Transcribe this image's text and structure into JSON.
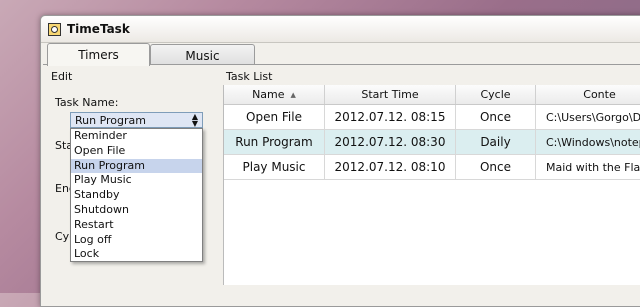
{
  "window": {
    "title": "TimeTask"
  },
  "tabs": [
    {
      "label": "Timers"
    },
    {
      "label": "Music"
    }
  ],
  "edit": {
    "group_label": "Edit",
    "task_name_label": "Task Name:",
    "start_label_partial": "Sta",
    "end_label_partial": "End",
    "cycle_label_partial": "Cyc",
    "selected_task": "Run Program",
    "options": [
      "Reminder",
      "Open File",
      "Run Program",
      "Play Music",
      "Standby",
      "Shutdown",
      "Restart",
      "Log off",
      "Lock"
    ]
  },
  "task_list": {
    "group_label": "Task List",
    "columns": [
      "Name",
      "Start Time",
      "Cycle",
      "Conte"
    ],
    "rows": [
      {
        "name": "Open File",
        "start": "2012.07.12. 08:15",
        "cycle": "Once",
        "content": "C:\\Users\\Gorgo\\Desk"
      },
      {
        "name": "Run Program",
        "start": "2012.07.12. 08:30",
        "cycle": "Daily",
        "content": "C:\\Windows\\notepa"
      },
      {
        "name": "Play Music",
        "start": "2012.07.12. 08:10",
        "cycle": "Once",
        "content": "Maid with the Flaxen"
      }
    ]
  },
  "colors": {
    "selected_row": "#dbeef0",
    "selected_option": "#c7d4ec",
    "window_bg": "#f2f0eb"
  }
}
